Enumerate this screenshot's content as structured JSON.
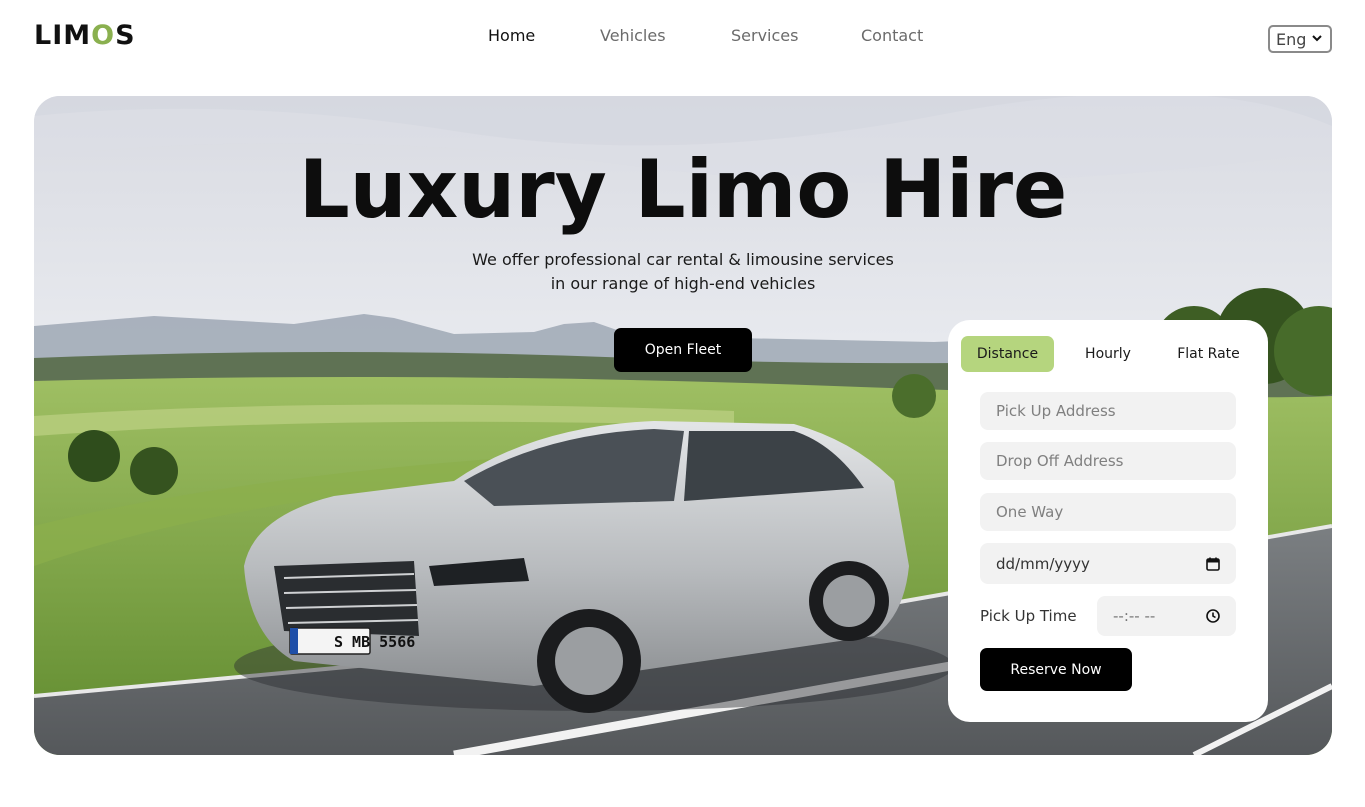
{
  "header": {
    "logo": {
      "prefix": "LIM",
      "accent": "O",
      "suffix": "S"
    },
    "nav": [
      "Home",
      "Vehicles",
      "Services",
      "Contact"
    ],
    "language": "Eng"
  },
  "hero": {
    "title": "Luxury Limo Hire",
    "subtitle_line1": "We offer professional car rental & limousine services",
    "subtitle_line2": "in our range of high-end vehicles",
    "cta": "Open Fleet",
    "car_plate": "S MB 5566"
  },
  "booking": {
    "tabs": [
      "Distance",
      "Hourly",
      "Flat Rate"
    ],
    "active_tab": "Distance",
    "pickup_placeholder": "Pick Up Address",
    "dropoff_placeholder": "Drop Off Address",
    "trip_type": "One Way",
    "date_placeholder": "dd/mm/yyyy",
    "pickup_time_label": "Pick Up Time",
    "time_placeholder": "--:-- --",
    "submit": "Reserve Now"
  },
  "colors": {
    "accent": "#b5d57e",
    "logo_accent": "#8ab04f",
    "button": "#000000"
  },
  "icons": {
    "language_dropdown": "chevron-down-icon",
    "date_field": "calendar-icon",
    "time_field": "clock-icon"
  }
}
